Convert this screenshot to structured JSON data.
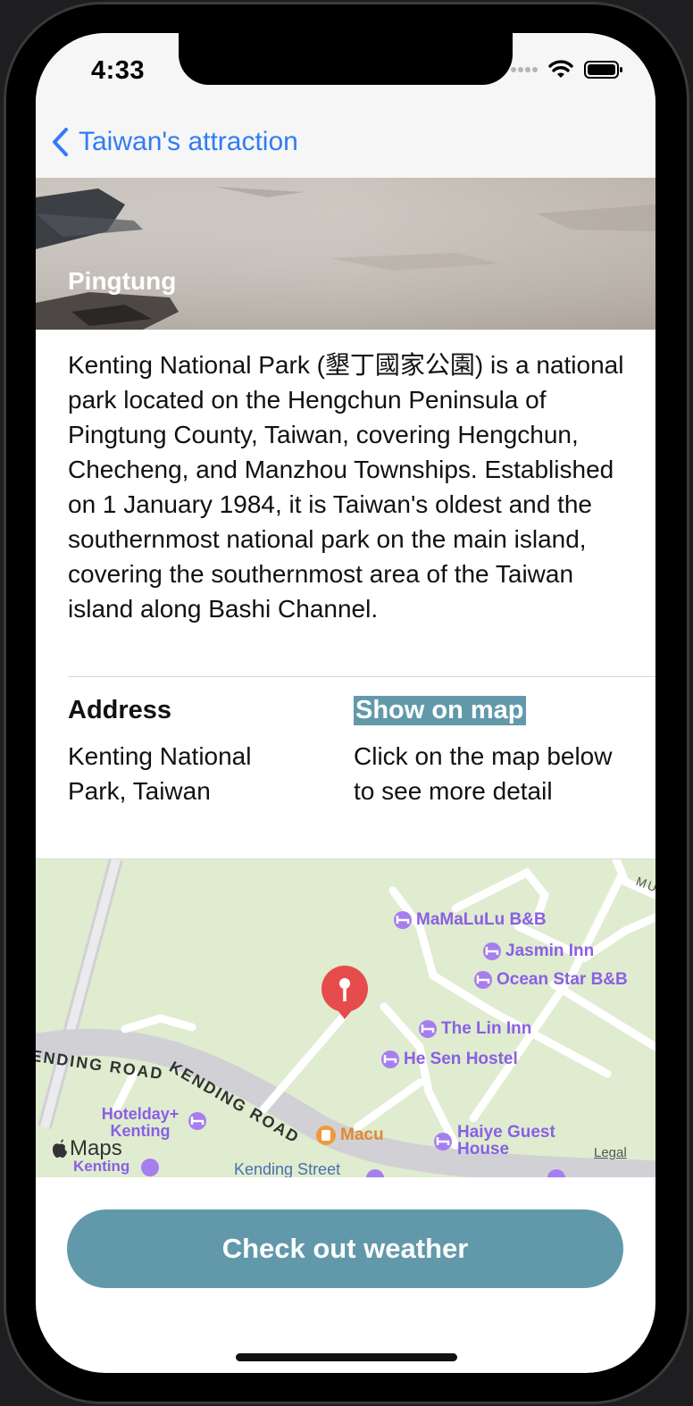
{
  "status_bar": {
    "time": "4:33"
  },
  "nav": {
    "back_label": "Taiwan's attraction"
  },
  "hero": {
    "title": "Pingtung"
  },
  "description": "Kenting National Park (墾丁國家公園) is a national park located on the Hengchun Peninsula of Pingtung County, Taiwan, covering Hengchun, Checheng, and Manzhou Townships. Established on 1 January 1984, it is Taiwan's oldest and the southernmost national park on the main island, covering the southernmost area of the Taiwan island along Bashi Channel.",
  "info": {
    "address_heading": "Address",
    "address_value": "Kenting National Park, Taiwan",
    "map_heading": "Show on map",
    "map_hint": "Click on the map below to see more detail"
  },
  "map": {
    "road_labels": [
      "ENDING ROAD",
      "KENDING ROAD",
      "Kending Street",
      "MU"
    ],
    "pois": [
      "MaMaLuLu B&B",
      "Jasmin Inn",
      "Ocean Star B&B",
      "The Lin Inn",
      "He Sen Hostel",
      "Haiye Guest House",
      "Hotelday+ Kenting",
      "Kenting",
      "Macu"
    ],
    "attribution": "Maps",
    "legal": "Legal",
    "colors": {
      "land": "#dfeccf",
      "road": "#ffffff",
      "major_road": "#d1d1d5",
      "poi": "#a77ef0",
      "food": "#ef9a3b",
      "pin": "#e74c4c"
    }
  },
  "button": {
    "label": "Check out weather"
  },
  "colors": {
    "accent": "#6199ab",
    "link": "#2f7cf6"
  }
}
